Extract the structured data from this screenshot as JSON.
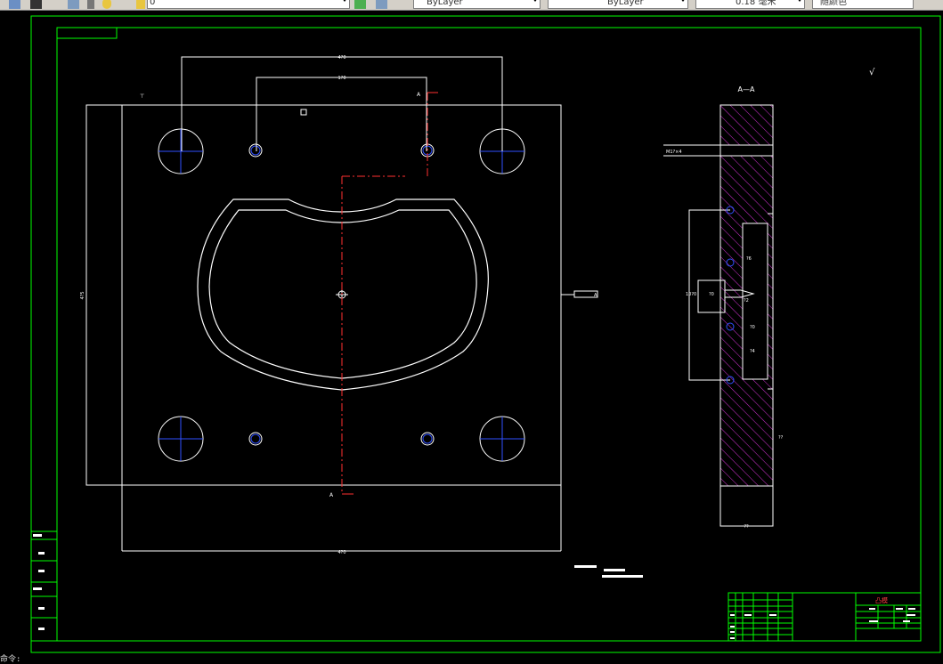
{
  "toolbar": {
    "layer_value": "0",
    "color_value": "ByLayer",
    "linetype_value": "ByLayer",
    "lineweight_value": "0.18 毫米",
    "plotstyle_value": "随颜色"
  },
  "drawing": {
    "section_title": "A—A",
    "section_label_top": "A",
    "section_label_bottom": "A",
    "dim_top_outer": "4?0",
    "dim_top_inner": "1?0",
    "dim_left": "4?5",
    "dim_bottom": "4?0",
    "datum_label": "A",
    "roughness_symbol": "√",
    "thread_note": "M1?×4",
    "side_dims": [
      "10?0",
      "?0",
      "?2",
      "?6",
      "?0",
      "?4",
      "??"
    ],
    "bottom_dim_side": "??"
  },
  "title_block": {
    "part_name": "凸模",
    "left_labels": [
      "",
      "",
      "",
      "",
      "",
      ""
    ]
  },
  "command": {
    "prompt": "命令:"
  }
}
